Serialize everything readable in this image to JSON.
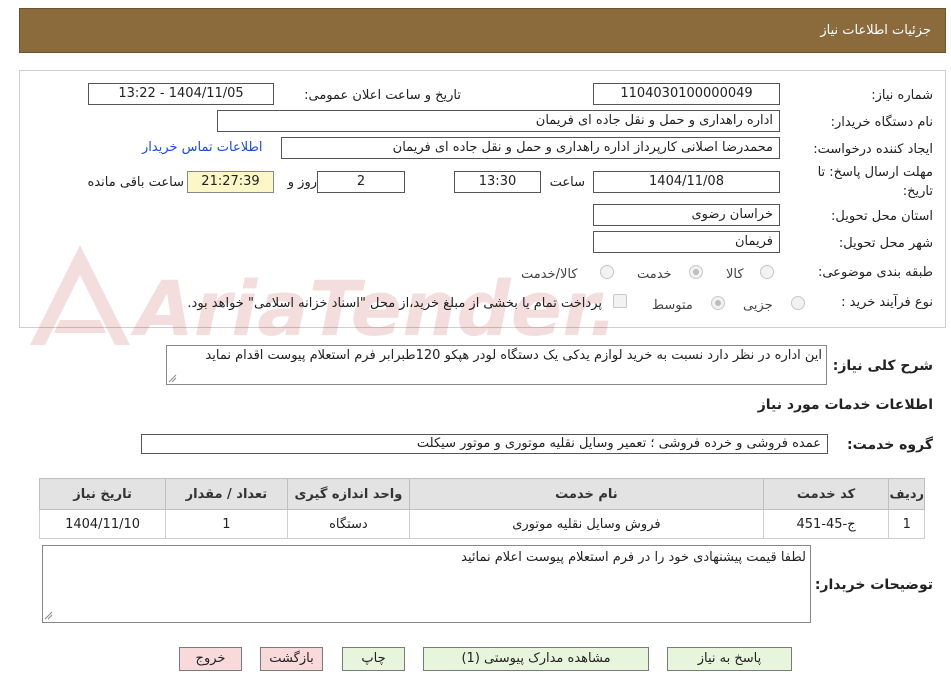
{
  "header": {
    "title": "جزئیات اطلاعات نیاز"
  },
  "fields": {
    "need_number_label": "شماره نیاز:",
    "need_number_value": "1104030100000049",
    "announce_label": "تاریخ و ساعت اعلان عمومی:",
    "announce_value": "1404/11/05 - 13:22",
    "buyer_org_label": "نام دستگاه خریدار:",
    "buyer_org_value": "اداره راهداری و حمل و نقل جاده ای فریمان",
    "creator_label": "ایجاد کننده درخواست:",
    "creator_value": "محمدرضا اصلانی کارپرداز اداره راهداری و حمل و نقل جاده ای فریمان",
    "contact_link": "اطلاعات تماس خریدار",
    "deadline_label_1": "مهلت ارسال پاسخ: تا",
    "deadline_label_2": "تاریخ:",
    "deadline_date": "1404/11/08",
    "time_label": "ساعت",
    "deadline_time": "13:30",
    "days_value": "2",
    "days_label": "روز و",
    "remaining_time": "21:27:39",
    "remaining_label": "ساعت باقی مانده",
    "province_label": "استان محل تحویل:",
    "province_value": "خراسان رضوی",
    "city_label": "شهر محل تحویل:",
    "city_value": "فریمان",
    "category_label": "طبقه بندی موضوعی:",
    "category_options": [
      "کالا",
      "خدمت",
      "کالا/خدمت"
    ],
    "process_label": "نوع فرآیند خرید :",
    "process_options": [
      "جزیی",
      "متوسط"
    ],
    "treasury_note": "پرداخت تمام یا بخشی از مبلغ خرید،از محل \"اسناد خزانه اسلامی\" خواهد بود."
  },
  "description": {
    "label": "شرح کلی نیاز:",
    "text": "این اداره در نظر دارد نسبت به خرید لوازم یدکی یک دستگاه لودر هپکو 120طبرابر فرم استعلام پیوست اقدام نماید"
  },
  "services": {
    "section_title": "اطلاعات خدمات مورد نیاز",
    "group_label": "گروه خدمت:",
    "group_value": "عمده فروشی و خرده فروشی ؛ تعمیر وسایل نقلیه موتوری و موتور سیکلت",
    "columns": [
      "ردیف",
      "کد خدمت",
      "نام خدمت",
      "واحد اندازه گیری",
      "تعداد / مقدار",
      "تاریخ نیاز"
    ],
    "rows": [
      [
        "1",
        "ج-45-451",
        "فروش وسایل نقلیه موتوری",
        "دستگاه",
        "1",
        "1404/11/10"
      ]
    ]
  },
  "notes": {
    "label": "توضیحات خریدار:",
    "text": "لطفا قیمت پیشنهادی خود را در فرم استعلام پیوست اعلام نمائید"
  },
  "buttons": {
    "reply": "پاسخ به نیاز",
    "attachments": "مشاهده مدارک پیوستی (1)",
    "print": "چاپ",
    "back": "بازگشت",
    "exit": "خروج"
  },
  "watermark": {
    "text": "AriaTender.neT"
  },
  "colors": {
    "header_bg": "#8b6a3c",
    "link": "#1a4ecc",
    "button_green": "#e7f5dc",
    "button_pink": "#f9dada",
    "remaining_bg": "#fdf7c8"
  }
}
